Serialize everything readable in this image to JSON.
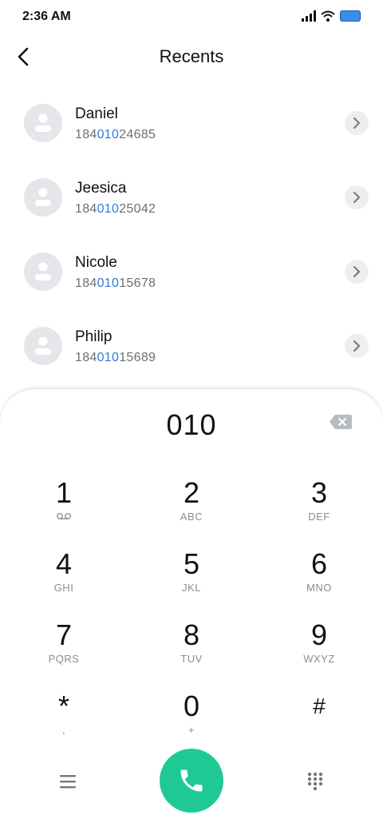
{
  "status_bar": {
    "time": "2:36 AM"
  },
  "header": {
    "title": "Recents"
  },
  "contacts": [
    {
      "name": "Daniel",
      "number_prefix": "184",
      "number_match": "010",
      "number_suffix": "24685"
    },
    {
      "name": "Jeesica",
      "number_prefix": "184",
      "number_match": "010",
      "number_suffix": "25042"
    },
    {
      "name": "Nicole",
      "number_prefix": "184",
      "number_match": "010",
      "number_suffix": "15678"
    },
    {
      "name": "Philip",
      "number_prefix": "184",
      "number_match": "010",
      "number_suffix": "15689"
    }
  ],
  "dialer": {
    "input": "010",
    "keys": [
      {
        "digit": "1",
        "letters": ""
      },
      {
        "digit": "2",
        "letters": "ABC"
      },
      {
        "digit": "3",
        "letters": "DEF"
      },
      {
        "digit": "4",
        "letters": "GHI"
      },
      {
        "digit": "5",
        "letters": "JKL"
      },
      {
        "digit": "6",
        "letters": "MNO"
      },
      {
        "digit": "7",
        "letters": "PQRS"
      },
      {
        "digit": "8",
        "letters": "TUV"
      },
      {
        "digit": "9",
        "letters": "WXYZ"
      },
      {
        "digit": "*",
        "letters": ","
      },
      {
        "digit": "0",
        "letters": "+"
      },
      {
        "digit": "#",
        "letters": ""
      }
    ]
  },
  "colors": {
    "accent": "#2e7be0",
    "call": "#1ec993",
    "battery": "#3b8de8"
  },
  "icons": [
    "back-icon",
    "signal-icon",
    "wifi-icon",
    "battery-icon",
    "avatar-icon",
    "chevron-right-icon",
    "backspace-icon",
    "voicemail-icon",
    "menu-icon",
    "phone-icon",
    "dialpad-icon"
  ]
}
